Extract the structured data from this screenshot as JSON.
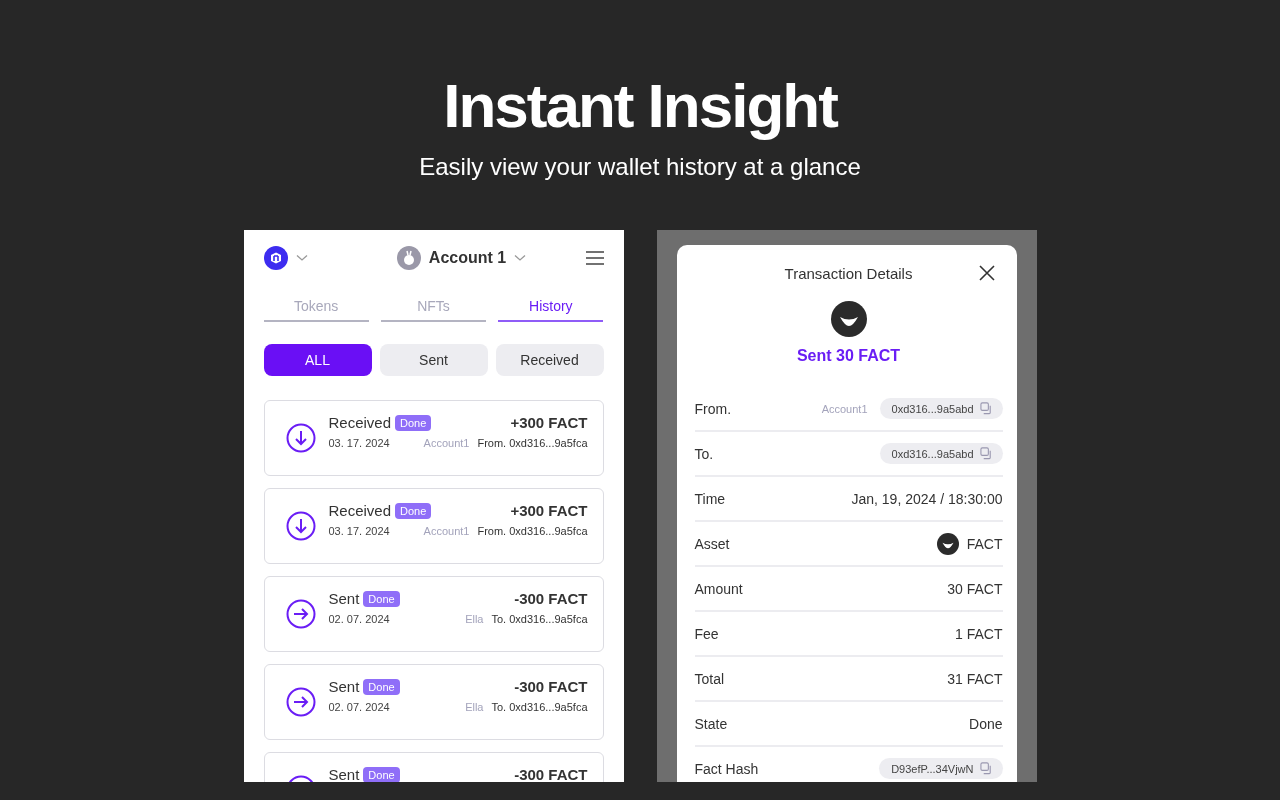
{
  "hero": {
    "title": "Instant Insight",
    "subtitle": "Easily view your wallet history at a glance"
  },
  "wallet": {
    "account": "Account 1",
    "tabs": [
      {
        "label": "Tokens",
        "selected": false
      },
      {
        "label": "NFTs",
        "selected": false
      },
      {
        "label": "History",
        "selected": true
      }
    ],
    "filters": [
      {
        "label": "ALL",
        "selected": true
      },
      {
        "label": "Sent",
        "selected": false
      },
      {
        "label": "Received",
        "selected": false
      }
    ],
    "transactions": [
      {
        "kind": "received",
        "type": "Received",
        "status": "Done",
        "amount": "+300 FACT",
        "date": "03. 17. 2024",
        "party": "Account1",
        "address": "From. 0xd316...9a5fca"
      },
      {
        "kind": "received",
        "type": "Received",
        "status": "Done",
        "amount": "+300 FACT",
        "date": "03. 17. 2024",
        "party": "Account1",
        "address": "From. 0xd316...9a5fca"
      },
      {
        "kind": "sent",
        "type": "Sent",
        "status": "Done",
        "amount": "-300 FACT",
        "date": "02. 07. 2024",
        "party": "Ella",
        "address": "To. 0xd316...9a5fca"
      },
      {
        "kind": "sent",
        "type": "Sent",
        "status": "Done",
        "amount": "-300 FACT",
        "date": "02. 07. 2024",
        "party": "Ella",
        "address": "To. 0xd316...9a5fca"
      },
      {
        "kind": "sent",
        "type": "Sent",
        "status": "Done",
        "amount": "-300 FACT"
      }
    ]
  },
  "details": {
    "title": "Transaction Details",
    "headline": "Sent 30 FACT",
    "rows": [
      {
        "kind": "address",
        "label": "From.",
        "note": "Account1",
        "value": "0xd316...9a5abd"
      },
      {
        "kind": "address",
        "label": "To.",
        "value": "0xd316...9a5abd"
      },
      {
        "kind": "text",
        "label": "Time",
        "value": "Jan, 19, 2024 / 18:30:00"
      },
      {
        "kind": "asset",
        "label": "Asset",
        "value": "FACT"
      },
      {
        "kind": "text",
        "label": "Amount",
        "value": "30 FACT"
      },
      {
        "kind": "text",
        "label": "Fee",
        "value": "1 FACT"
      },
      {
        "kind": "text",
        "label": "Total",
        "value": "31 FACT"
      },
      {
        "kind": "text",
        "label": "State",
        "value": "Done"
      },
      {
        "kind": "address",
        "label": "Fact Hash",
        "value": "D93efP...34VjwN"
      }
    ]
  }
}
